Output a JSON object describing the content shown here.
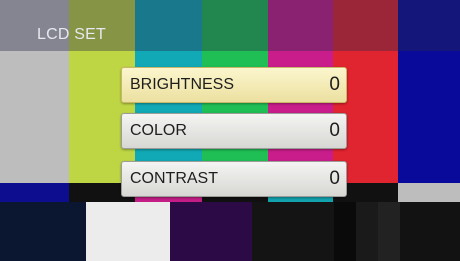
{
  "title": "LCD SET",
  "menu": {
    "items": [
      {
        "label": "BRIGHTNESS",
        "value": "0",
        "selected": true
      },
      {
        "label": "COLOR",
        "value": "0",
        "selected": false
      },
      {
        "label": "CONTRAST",
        "value": "0",
        "selected": false
      }
    ]
  },
  "colors": {
    "selected_item": "#f5eeb8",
    "item": "#e3e3e0",
    "header_overlay": "#5a5f86",
    "bar_gray": "#bdbdbd",
    "bar_yellow": "#bed644",
    "bar_cyan": "#11a9b5",
    "bar_green": "#1fbf55",
    "bar_magenta": "#c91d8b",
    "bar_red": "#e02430",
    "bar_blue": "#0a0a9a"
  }
}
